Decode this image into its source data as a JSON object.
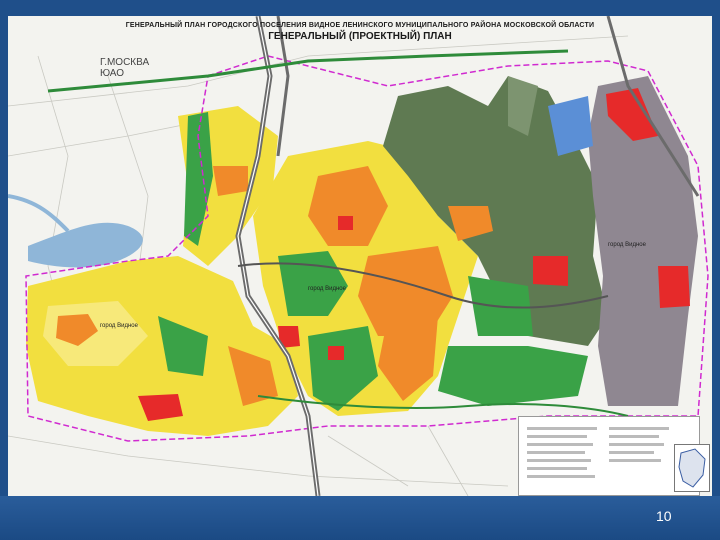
{
  "title_line1": "ГЕНЕРАЛЬНЫЙ ПЛАН ГОРОДСКОГО ПОСЕЛЕНИЯ ВИДНОЕ ЛЕНИНСКОГО МУНИЦИПАЛЬНОГО РАЙОНА МОСКОВСКОЙ ОБЛАСТИ",
  "title_line2": "ГЕНЕРАЛЬНЫЙ (ПРОЕКТНЫЙ) ПЛАН",
  "labels": {
    "moscow": "Г.МОСКВА",
    "district": "ЮАО",
    "city_right": "город Видное",
    "city_left": "город Видное",
    "center": "город Видное"
  },
  "page_number": "10",
  "colors": {
    "yellow": "#f2df3f",
    "orange": "#f08a2a",
    "green": "#3aa247",
    "dark_green": "#5f7a52",
    "grey": "#8f8791",
    "red": "#e62a2a",
    "blue": "#5b8fd6",
    "boundary": "#d02ad0"
  }
}
